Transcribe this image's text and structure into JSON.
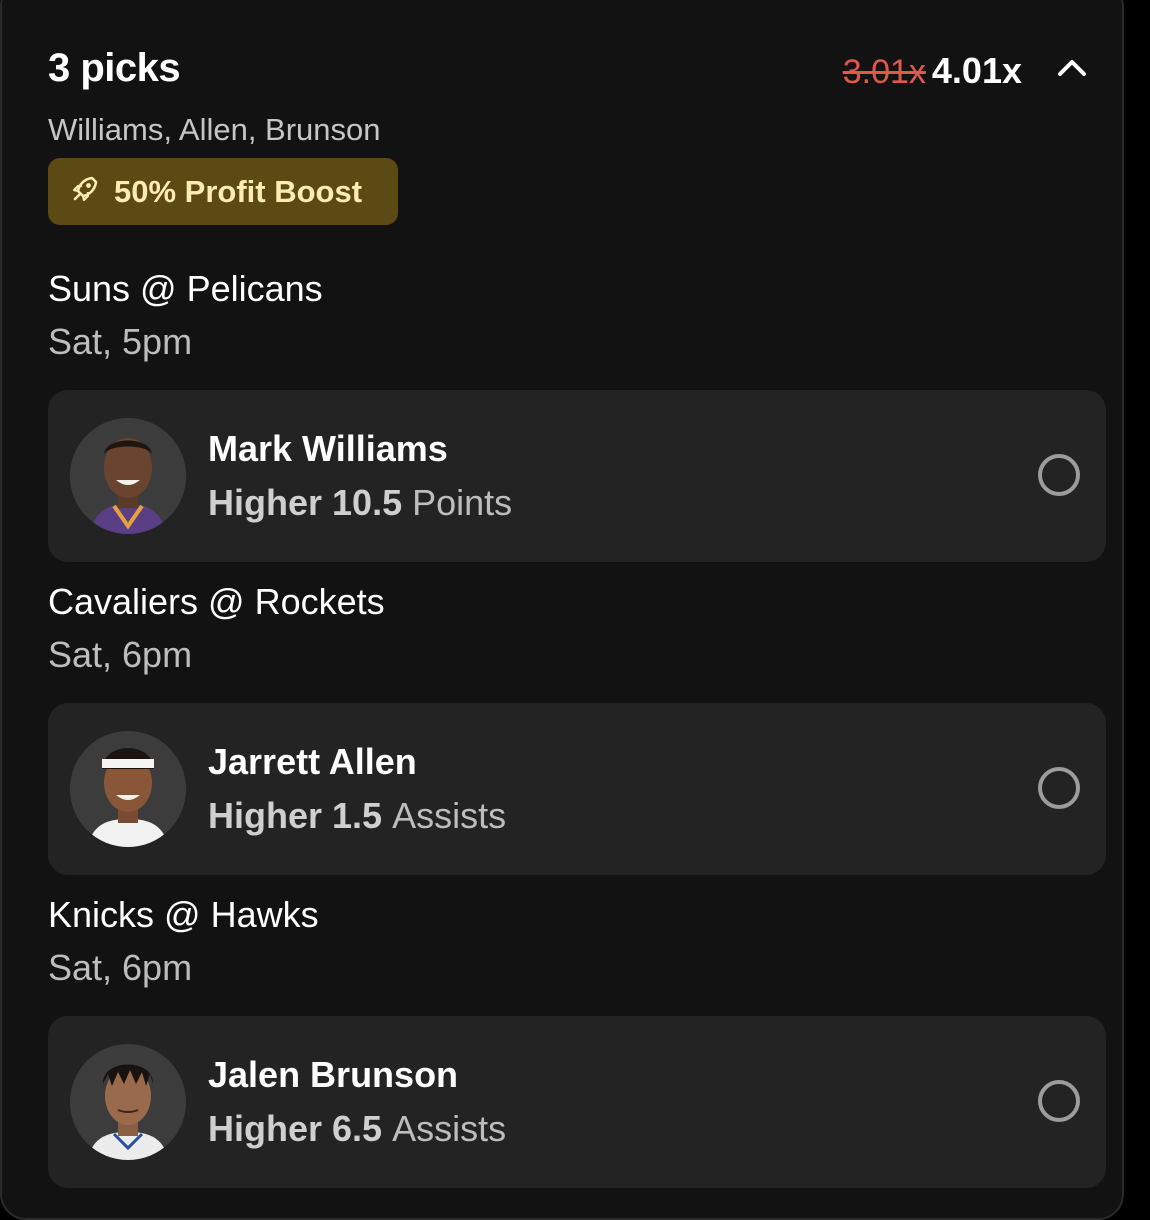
{
  "header": {
    "title": "3 picks",
    "old_multiplier": "3.01x",
    "new_multiplier": "4.01x",
    "collapse_icon": "chevron-up-icon",
    "players_summary": "Williams, Allen, Brunson"
  },
  "boost": {
    "icon": "rocket-icon",
    "label": "50% Profit Boost",
    "color": "#5c4a14",
    "text_color": "#fbecb2"
  },
  "colors": {
    "old_multiplier": "#e0574f",
    "background": "#121212",
    "pick_card": "#232323"
  },
  "games": [
    {
      "matchup": "Suns @ Pelicans",
      "time": "Sat, 5pm",
      "player": "Mark Williams",
      "direction": "Higher",
      "line": "10.5",
      "stat": "Points"
    },
    {
      "matchup": "Cavaliers @ Rockets",
      "time": "Sat, 6pm",
      "player": "Jarrett Allen",
      "direction": "Higher",
      "line": "1.5",
      "stat": "Assists"
    },
    {
      "matchup": "Knicks @ Hawks",
      "time": "Sat, 6pm",
      "player": "Jalen Brunson",
      "direction": "Higher",
      "line": "6.5",
      "stat": "Assists"
    }
  ]
}
